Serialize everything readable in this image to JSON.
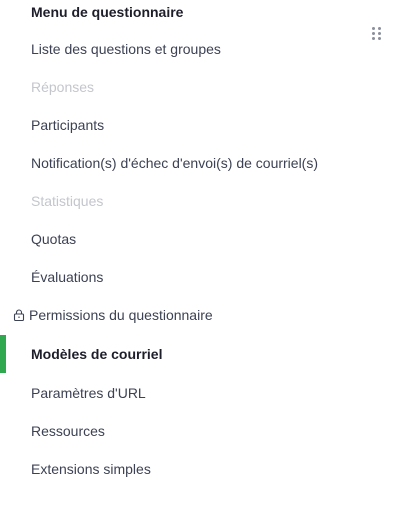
{
  "menu": {
    "title": "Menu de questionnaire",
    "items": [
      {
        "label": "Liste des questions et groupes",
        "state": "normal"
      },
      {
        "label": "Réponses",
        "state": "disabled"
      },
      {
        "label": "Participants",
        "state": "normal"
      },
      {
        "label": "Notification(s) d'échec d'envoi(s) de courriel(s)",
        "state": "normal"
      },
      {
        "label": "Statistiques",
        "state": "disabled"
      },
      {
        "label": "Quotas",
        "state": "normal"
      },
      {
        "label": "Évaluations",
        "state": "normal"
      },
      {
        "label": "Permissions du questionnaire",
        "state": "locked",
        "icon": "lock-icon"
      },
      {
        "label": "Modèles de courriel",
        "state": "active"
      },
      {
        "label": "Paramètres d'URL",
        "state": "normal"
      },
      {
        "label": "Ressources",
        "state": "normal"
      },
      {
        "label": "Extensions simples",
        "state": "normal"
      }
    ]
  },
  "drag_handle": {
    "icon": "drag-dots-icon"
  },
  "colors": {
    "text": "#3c4254",
    "title": "#1e1e2b",
    "disabled": "#c4c6cd",
    "active_accent": "#2fa84f"
  }
}
